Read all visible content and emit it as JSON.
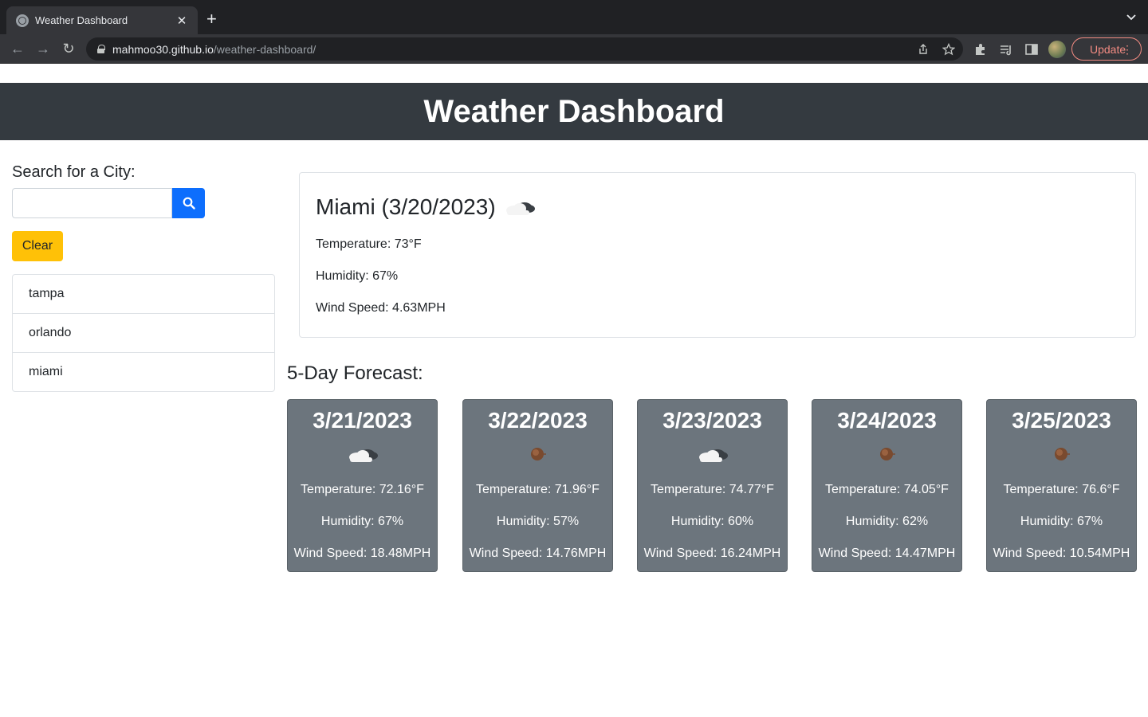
{
  "browser": {
    "tab_title": "Weather Dashboard",
    "url_host": "mahmoo30.github.io",
    "url_path": "/weather-dashboard/",
    "update_label": "Update"
  },
  "header": {
    "title": "Weather Dashboard"
  },
  "search": {
    "label": "Search for a City:",
    "value": "",
    "placeholder": "",
    "clear_label": "Clear"
  },
  "history": [
    "tampa",
    "orlando",
    "miami"
  ],
  "current": {
    "title": "Miami (3/20/2023)",
    "icon": "partly-cloudy-night-icon",
    "temperature": "Temperature: 73°F",
    "humidity": "Humidity: 67%",
    "wind": "Wind Speed: 4.63MPH"
  },
  "forecast_title": "5-Day Forecast:",
  "forecast": [
    {
      "date": "3/21/2023",
      "icon": "partly-cloudy-night-icon",
      "temperature": "Temperature: 72.16°F",
      "humidity": "Humidity: 67%",
      "wind": "Wind Speed: 18.48MPH"
    },
    {
      "date": "3/22/2023",
      "icon": "clear-night-icon",
      "temperature": "Temperature: 71.96°F",
      "humidity": "Humidity: 57%",
      "wind": "Wind Speed: 14.76MPH"
    },
    {
      "date": "3/23/2023",
      "icon": "partly-cloudy-night-icon",
      "temperature": "Temperature: 74.77°F",
      "humidity": "Humidity: 60%",
      "wind": "Wind Speed: 16.24MPH"
    },
    {
      "date": "3/24/2023",
      "icon": "clear-night-icon",
      "temperature": "Temperature: 74.05°F",
      "humidity": "Humidity: 62%",
      "wind": "Wind Speed: 14.47MPH"
    },
    {
      "date": "3/25/2023",
      "icon": "clear-night-icon",
      "temperature": "Temperature: 76.6°F",
      "humidity": "Humidity: 67%",
      "wind": "Wind Speed: 10.54MPH"
    }
  ],
  "colors": {
    "header_bg": "#343a40",
    "search_button": "#0d6efd",
    "clear_button": "#ffc107",
    "card_bg": "#6c757d"
  }
}
